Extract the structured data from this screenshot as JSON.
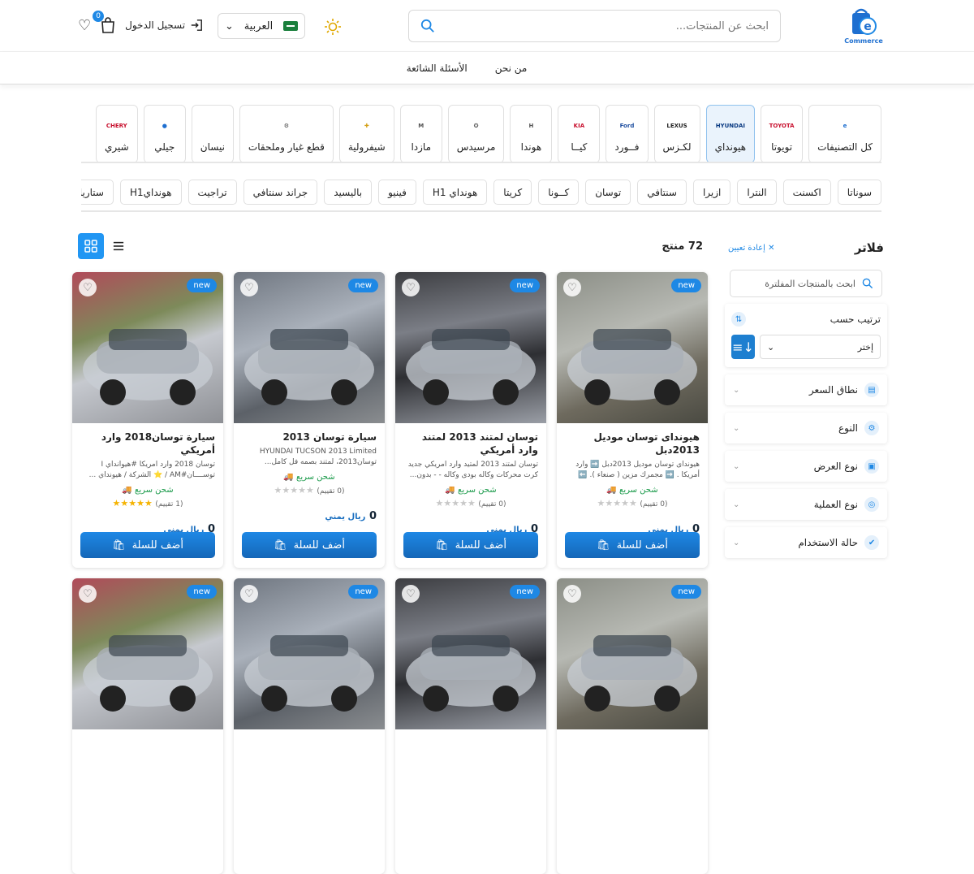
{
  "header": {
    "logo_text": "Commerce",
    "logo_letter": "e",
    "search_placeholder": "ابحث عن المنتجات...",
    "language": "العربية",
    "cart_count": "0",
    "login_label": "تسجيل الدخول"
  },
  "nav": {
    "items": [
      "من نحن",
      "الأسئلة الشائعة"
    ]
  },
  "categories": [
    {
      "label": "كل التصنيفات",
      "logo": "e"
    },
    {
      "label": "تويوتا",
      "logo": "TOYOTA"
    },
    {
      "label": "هيونداي",
      "logo": "HYUNDAI",
      "active": true
    },
    {
      "label": "لكـزس",
      "logo": "LEXUS"
    },
    {
      "label": "فــورد",
      "logo": "Ford"
    },
    {
      "label": "كيــا",
      "logo": "KIA"
    },
    {
      "label": "هوندا",
      "logo": "H"
    },
    {
      "label": "مرسيدس",
      "logo": "✪"
    },
    {
      "label": "مازدا",
      "logo": "M"
    },
    {
      "label": "شيفرولية",
      "logo": "✚"
    },
    {
      "label": "قطع غيار وملحقات",
      "logo": "⚙"
    },
    {
      "label": "نيسان",
      "logo": ""
    },
    {
      "label": "جيلي",
      "logo": "●"
    },
    {
      "label": "شيري",
      "logo": "CHERY"
    }
  ],
  "models": [
    "سوناتا",
    "اكسنت",
    "النترا",
    "ازيرا",
    "سنتافي",
    "توسان",
    "كــونا",
    "كريتا",
    "هونداي H1",
    "فينيو",
    "باليسيد",
    "جراند سنتافي",
    "تراجيت",
    "هونداي‌H1",
    "ستاريا"
  ],
  "sidebar": {
    "title": "فلاتر",
    "reset": "إعادة تعيين",
    "search_placeholder": "ابحث بالمنتجات المفلترة",
    "sort_title": "ترتيب حسب",
    "sort_value": "إختر",
    "filters": [
      "نطاق السعر",
      "النوع",
      "نوع العرض",
      "نوع العملية",
      "حالة الاستخدام"
    ]
  },
  "toolbar": {
    "count": "72 منتج"
  },
  "products": [
    {
      "title": "هيونداى توسان موديل 2013دبل",
      "desc": "هيونداى توسان موديل 2013دبل ➡️ وارد أمريكا . ➡️ مجمرك مزين ( صنعاء ). ⬅️",
      "ship": "شحن سريع",
      "rating": "(0 تقييم)",
      "price": "0",
      "currency": "ريال يمني",
      "new": "new",
      "add": "أضف للسلة",
      "stars": 0
    },
    {
      "title": "توسان لمتند 2013 لمتند وارد أمريكي",
      "desc": "توسان لمتند 2013 لمتيد وارد امريكي جديد كرت محركات وكاله بودى وكاله - - بدون...",
      "ship": "شحن سريع",
      "rating": "(0 تقييم)",
      "price": "0",
      "currency": "ريال يمني",
      "new": "new",
      "add": "أضف للسلة",
      "stars": 0
    },
    {
      "title": "سيارة توسان 2013",
      "desc": "HYUNDAI TUCSON 2013 Limited توسان2013، لمتند بصمه فل كامل...",
      "ship": "شحن سريع",
      "rating": "(0 تقييم)",
      "price": "0",
      "currency": "ريال يمني",
      "new": "new",
      "add": "أضف للسلة",
      "stars": 0
    },
    {
      "title": "سيارة توسان2018 وارد أمريكي",
      "desc": "توسان 2018 وارد امريكا #هيوانداي I توســــان#AM / ⭐ الشركة / هيونداي ...",
      "ship": "شحن سريع",
      "rating": "(1 تقييم)",
      "price": "0",
      "currency": "ريال يمني",
      "new": "new",
      "add": "أضف للسلة",
      "stars": 5
    }
  ],
  "row2": [
    {
      "new": "new"
    },
    {
      "new": "new"
    },
    {
      "new": "new"
    },
    {
      "new": "new"
    }
  ]
}
